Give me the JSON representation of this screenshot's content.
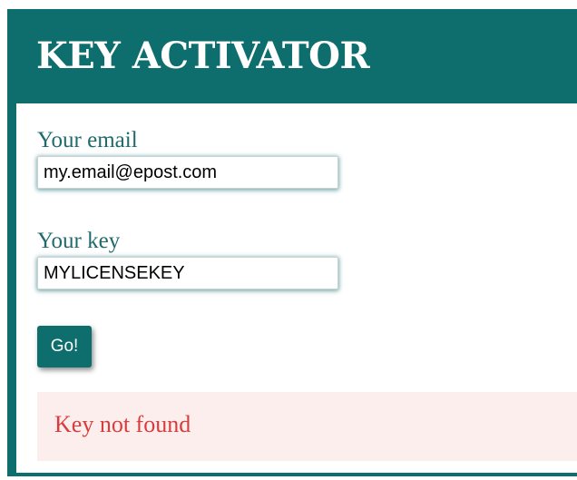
{
  "header": {
    "title": "KEY ACTIVATOR"
  },
  "form": {
    "email": {
      "label": "Your email",
      "value": "my.email@epost.com"
    },
    "key": {
      "label": "Your key",
      "value": "MYLICENSEKEY"
    },
    "submit_label": "Go!"
  },
  "alert": {
    "message": "Key not found"
  },
  "colors": {
    "brand": "#0e6d6d",
    "alert_text": "#d83c3c",
    "alert_background": "#fdeeee"
  }
}
